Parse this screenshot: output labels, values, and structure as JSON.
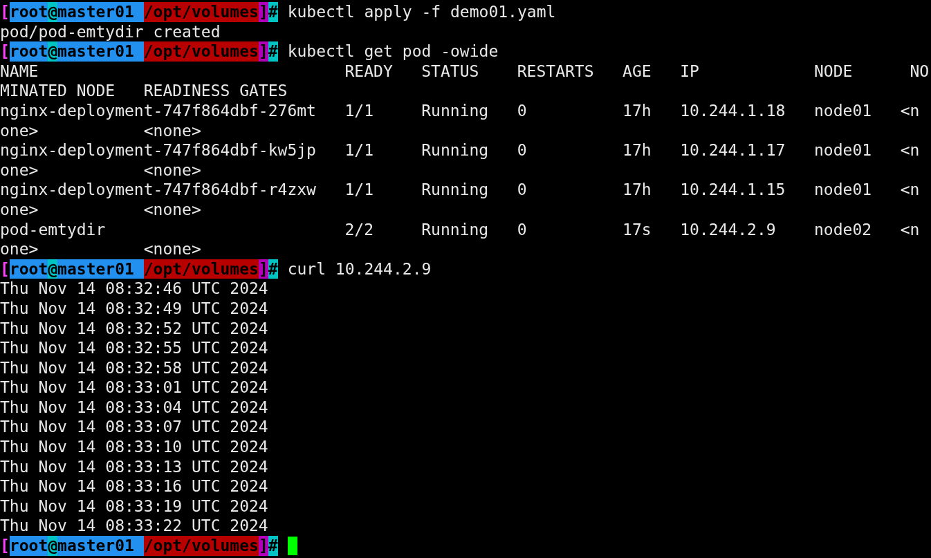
{
  "terminal": {
    "lines": [
      {
        "kind": "prompt",
        "prompt": {
          "open": "[",
          "user": "root",
          "at": "@",
          "host": "master01",
          "path": "/opt/volumes",
          "close": "]",
          "sign": "#"
        },
        "command": "kubectl apply -f demo01.yaml",
        "cursor": false
      },
      {
        "kind": "output",
        "text": "pod/pod-emtydir created"
      },
      {
        "kind": "prompt",
        "prompt": {
          "open": "[",
          "user": "root",
          "at": "@",
          "host": "master01",
          "path": "/opt/volumes",
          "close": "]",
          "sign": "#"
        },
        "command": "kubectl get pod -owide",
        "cursor": false
      },
      {
        "kind": "output",
        "text": "NAME                                READY   STATUS    RESTARTS   AGE   IP            NODE      NO"
      },
      {
        "kind": "output",
        "text": "MINATED NODE   READINESS GATES"
      },
      {
        "kind": "output",
        "text": "nginx-deployment-747f864dbf-276mt   1/1     Running   0          17h   10.244.1.18   node01   <n"
      },
      {
        "kind": "output",
        "text": "one>           <none>"
      },
      {
        "kind": "output",
        "text": "nginx-deployment-747f864dbf-kw5jp   1/1     Running   0          17h   10.244.1.17   node01   <n"
      },
      {
        "kind": "output",
        "text": "one>           <none>"
      },
      {
        "kind": "output",
        "text": "nginx-deployment-747f864dbf-r4zxw   1/1     Running   0          17h   10.244.1.15   node01   <n"
      },
      {
        "kind": "output",
        "text": "one>           <none>"
      },
      {
        "kind": "output",
        "text": "pod-emtydir                         2/2     Running   0          17s   10.244.2.9    node02   <n"
      },
      {
        "kind": "output",
        "text": "one>           <none>"
      },
      {
        "kind": "prompt",
        "prompt": {
          "open": "[",
          "user": "root",
          "at": "@",
          "host": "master01",
          "path": "/opt/volumes",
          "close": "]",
          "sign": "#"
        },
        "command": "curl 10.244.2.9",
        "cursor": false
      },
      {
        "kind": "output",
        "text": "Thu Nov 14 08:32:46 UTC 2024"
      },
      {
        "kind": "output",
        "text": "Thu Nov 14 08:32:49 UTC 2024"
      },
      {
        "kind": "output",
        "text": "Thu Nov 14 08:32:52 UTC 2024"
      },
      {
        "kind": "output",
        "text": "Thu Nov 14 08:32:55 UTC 2024"
      },
      {
        "kind": "output",
        "text": "Thu Nov 14 08:32:58 UTC 2024"
      },
      {
        "kind": "output",
        "text": "Thu Nov 14 08:33:01 UTC 2024"
      },
      {
        "kind": "output",
        "text": "Thu Nov 14 08:33:04 UTC 2024"
      },
      {
        "kind": "output",
        "text": "Thu Nov 14 08:33:07 UTC 2024"
      },
      {
        "kind": "output",
        "text": "Thu Nov 14 08:33:10 UTC 2024"
      },
      {
        "kind": "output",
        "text": "Thu Nov 14 08:33:13 UTC 2024"
      },
      {
        "kind": "output",
        "text": "Thu Nov 14 08:33:16 UTC 2024"
      },
      {
        "kind": "output",
        "text": "Thu Nov 14 08:33:19 UTC 2024"
      },
      {
        "kind": "output",
        "text": "Thu Nov 14 08:33:22 UTC 2024"
      },
      {
        "kind": "prompt",
        "prompt": {
          "open": "[",
          "user": "root",
          "at": "@",
          "host": "master01",
          "path": "/opt/volumes",
          "close": "]",
          "sign": "#"
        },
        "cursor": true
      }
    ]
  }
}
